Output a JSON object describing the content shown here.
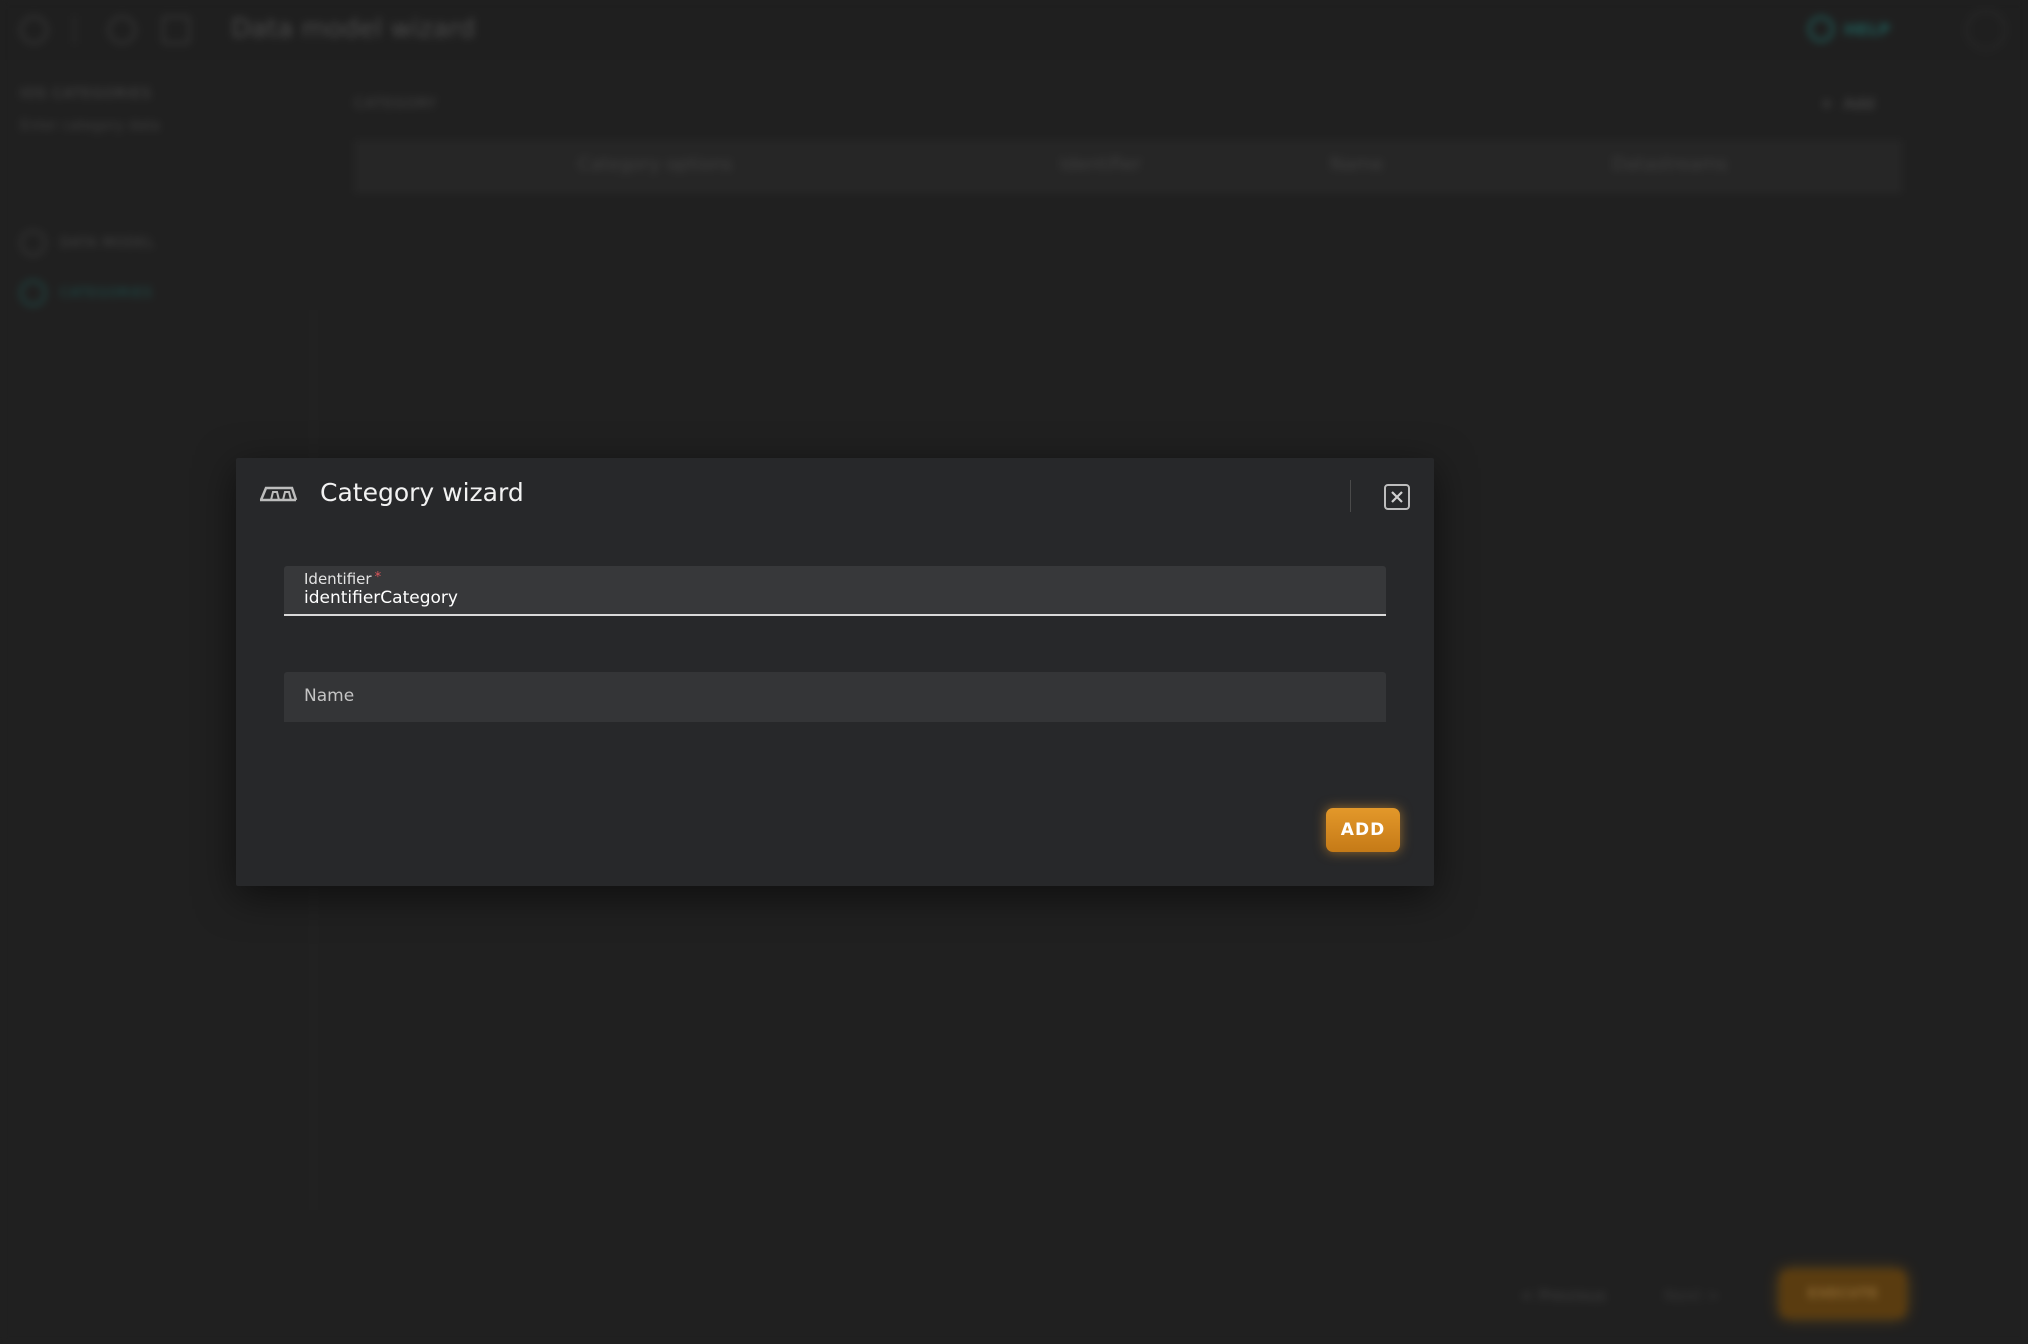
{
  "app": {
    "title": "Data model wizard",
    "help_label": "HELP",
    "sidebar": {
      "heading": "IOS CATEGORIES",
      "subtitle": "Enter category data",
      "steps": [
        "DATA MODEL",
        "CATEGORIES"
      ]
    },
    "main": {
      "section_label": "CATEGORY",
      "add_label": "Add",
      "table_headers": [
        "Category options",
        "Identifier",
        "Name",
        "Datastreams"
      ]
    },
    "footer": {
      "previous": "< Previous",
      "next": "Next >",
      "execute": "EXECUTE"
    }
  },
  "modal": {
    "title": "Category wizard",
    "icon": "category-icon",
    "close_icon": "close-icon",
    "identifier": {
      "label": "Identifier",
      "required_mark": "*",
      "value": "identifierCategory"
    },
    "name": {
      "placeholder": "Name"
    },
    "add_button": "ADD"
  },
  "colors": {
    "accent": "#d98a22",
    "background": "#202020",
    "modal_background": "#27282a",
    "required": "#e0565b"
  }
}
